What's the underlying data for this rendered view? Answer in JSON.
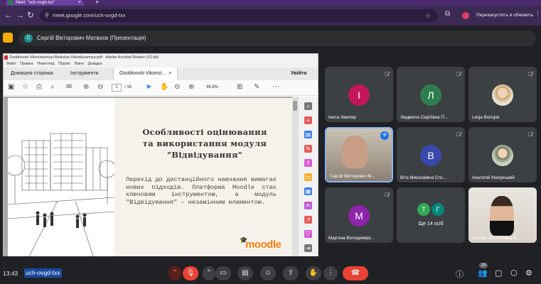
{
  "browser": {
    "tab_title": "Meet: \"uch-ovgd-txx\"",
    "url": "meet.google.com/uch-ovgd-txx",
    "restart_label": "Перезапустить и обновить",
    "profile_initial": "I"
  },
  "presentation_bar": {
    "avatar_initial": "С",
    "label": "Сергій Вікторович Матвєєв (Презентація)"
  },
  "acrobat": {
    "title": "Osoblivosti-Vikoristannya-Modulya-Vidviduvannya.pdf - Adobe Acrobat Reader (32-bit)",
    "menu": [
      "Файл",
      "Правка",
      "Перегляд",
      "Підпис",
      "Вікно",
      "Довідка"
    ],
    "tabs": [
      "Домашня сторінка",
      "Інструменти",
      "Osoblivosti-Vikorist..."
    ],
    "tab_close": "×",
    "signin": "Увійти",
    "page_current": "1",
    "page_total": "/ 16",
    "zoom": "46,6%",
    "slide": {
      "heading_lines": [
        "Особливості оцінювання",
        "та використання модуля",
        "\"Відвідування\""
      ],
      "paragraph": "Перехід до дистанційного навчання вимагає нових підходів. Платформа Moodle стає ключовим інструментом, а модуль \"Відвідування\" – незамінним елементом.",
      "logo_text": "moodle"
    }
  },
  "participants": [
    {
      "name": "Інеса Хмеляр",
      "initial": "І",
      "color": "#c2185b",
      "muted": true
    },
    {
      "name": "Людмила Сергіївна П...",
      "initial": "Л",
      "color": "#2e7d4f",
      "muted": true
    },
    {
      "name": "Lesja Borisjuk",
      "initial": "",
      "color": "#c9a26b",
      "muted": true
    },
    {
      "name": "Сергій Вікторович М...",
      "initial": "",
      "color": "#8a7f74",
      "muted": false
    },
    {
      "name": "Віта Миколаївна Сте...",
      "initial": "В",
      "color": "#3949ab",
      "muted": true
    },
    {
      "name": "Анатолій Кокорський",
      "initial": "",
      "color": "#7a8a6a",
      "muted": true
    },
    {
      "name": "Мар'яна Володимирі...",
      "initial": "М",
      "color": "#8e24aa",
      "muted": true
    },
    {
      "name": "Ще 14 осіб",
      "initial": "",
      "color": "",
      "muted": false
    },
    {
      "name": "Галина Анатоліївна Д...",
      "initial": "",
      "color": "#d9c8b8",
      "muted": true
    }
  ],
  "others_avatars": [
    "Т",
    "Г"
  ],
  "bottom": {
    "time": "13:43",
    "meeting_code": "uch-ovgd-txx",
    "people_count": "23"
  }
}
